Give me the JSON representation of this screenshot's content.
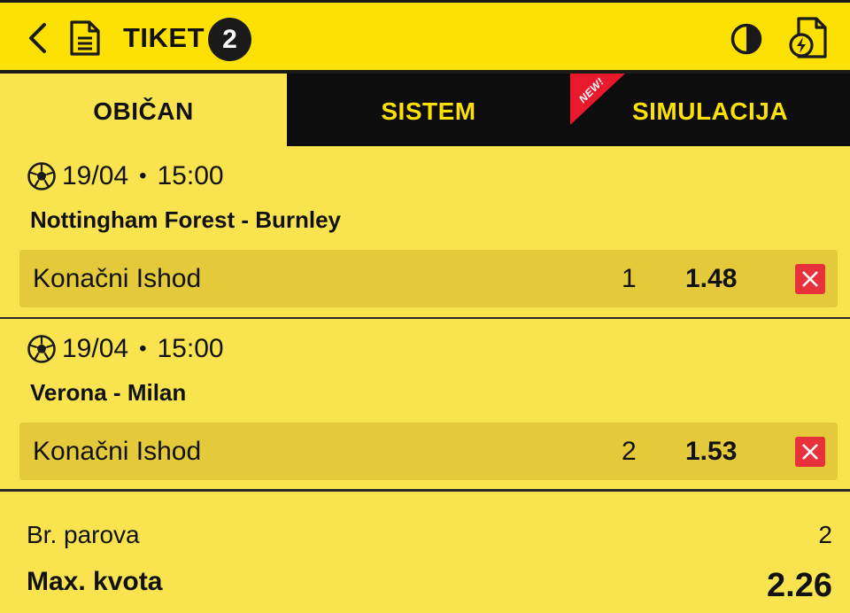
{
  "header": {
    "back_icon": "chevron-left-icon",
    "doc_icon": "document-icon",
    "title": "TIKET",
    "count": "2",
    "contrast_icon": "contrast-icon",
    "flash_icon": "flash-document-icon"
  },
  "tabs": [
    {
      "label": "OBIČAN",
      "active": true
    },
    {
      "label": "SISTEM",
      "active": false
    },
    {
      "label": "SIMULACIJA",
      "active": false,
      "badge": "NEW!"
    }
  ],
  "matches": [
    {
      "sport_icon": "soccer-ball-icon",
      "date": "19/04",
      "time": "15:00",
      "teams": "Nottingham Forest - Burnley",
      "market": "Konačni Ishod",
      "outcome": "1",
      "odd": "1.48"
    },
    {
      "sport_icon": "soccer-ball-icon",
      "date": "19/04",
      "time": "15:00",
      "teams": "Verona - Milan",
      "market": "Konačni Ishod",
      "outcome": "2",
      "odd": "1.53"
    }
  ],
  "summary": {
    "pairs_label": "Br. parova",
    "pairs_value": "2",
    "max_odd_label": "Max. kvota",
    "max_odd_value": "2.26"
  },
  "colors": {
    "header_bg": "#fde102",
    "body_bg": "#f9e34e",
    "pick_row_bg": "#e4c93a",
    "tab_dark": "#0d0d0d",
    "tab_text": "#fde102",
    "remove_red": "#e8323b",
    "new_badge": "#e8192c"
  }
}
